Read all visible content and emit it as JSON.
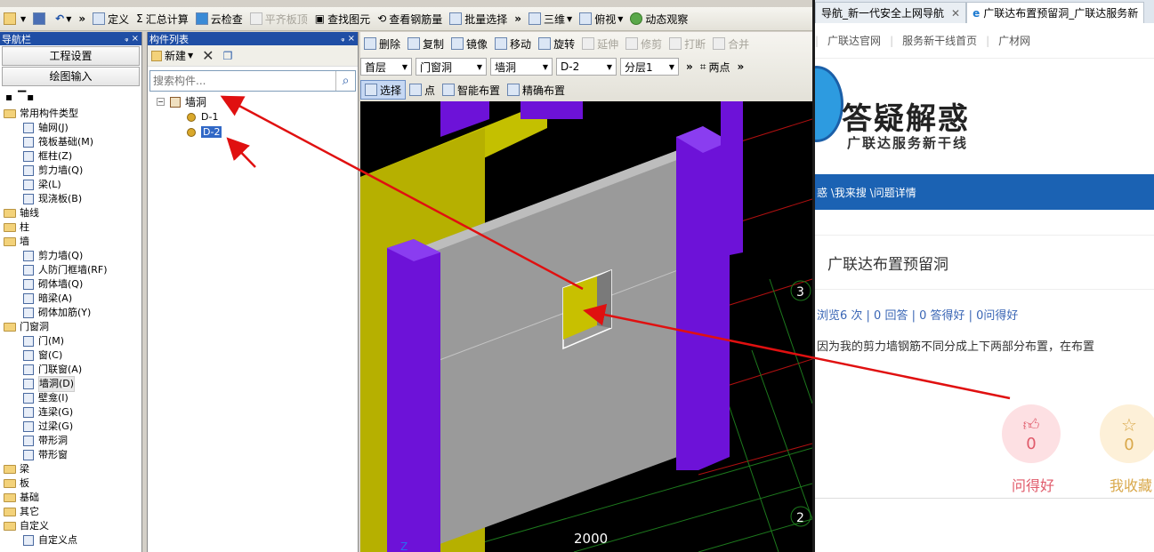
{
  "toolbar": {
    "items": [
      {
        "label": "",
        "icon": "open-folder-icon"
      },
      {
        "label": "",
        "icon": "save-icon"
      },
      {
        "label": "",
        "icon": "undo-icon"
      },
      {
        "label": "定义",
        "icon": "define-icon"
      },
      {
        "label": "汇总计算",
        "icon": "sigma-icon"
      },
      {
        "label": "云检查",
        "icon": "cloud-check-icon"
      },
      {
        "label": "平齐板顶",
        "icon": "align-slab-icon",
        "disabled": true
      },
      {
        "label": "查找图元",
        "icon": "binoculars-icon"
      },
      {
        "label": "查看钢筋量",
        "icon": "view-rebar-icon"
      },
      {
        "label": "批量选择",
        "icon": "batch-select-icon"
      },
      {
        "label": "三维",
        "icon": "cube-icon"
      },
      {
        "label": "俯视",
        "icon": "top-view-icon"
      },
      {
        "label": "动态观察",
        "icon": "orbit-icon"
      }
    ]
  },
  "nav_panel": {
    "title": "导航栏",
    "buttons": [
      "工程设置",
      "绘图输入"
    ],
    "tree": [
      {
        "label": "常用构件类型",
        "type": "folder",
        "level": 0
      },
      {
        "label": "轴网(J)",
        "type": "item",
        "level": 1
      },
      {
        "label": "筏板基础(M)",
        "type": "item",
        "level": 1
      },
      {
        "label": "框柱(Z)",
        "type": "item",
        "level": 1
      },
      {
        "label": "剪力墙(Q)",
        "type": "item",
        "level": 1
      },
      {
        "label": "梁(L)",
        "type": "item",
        "level": 1
      },
      {
        "label": "现浇板(B)",
        "type": "item",
        "level": 1
      },
      {
        "label": "轴线",
        "type": "folder",
        "level": 0
      },
      {
        "label": "柱",
        "type": "folder",
        "level": 0
      },
      {
        "label": "墙",
        "type": "folder",
        "level": 0
      },
      {
        "label": "剪力墙(Q)",
        "type": "item",
        "level": 1
      },
      {
        "label": "人防门框墙(RF)",
        "type": "item",
        "level": 1
      },
      {
        "label": "砌体墙(Q)",
        "type": "item",
        "level": 1
      },
      {
        "label": "暗梁(A)",
        "type": "item",
        "level": 1
      },
      {
        "label": "砌体加筋(Y)",
        "type": "item",
        "level": 1
      },
      {
        "label": "门窗洞",
        "type": "folder",
        "level": 0
      },
      {
        "label": "门(M)",
        "type": "item",
        "level": 1
      },
      {
        "label": "窗(C)",
        "type": "item",
        "level": 1
      },
      {
        "label": "门联窗(A)",
        "type": "item",
        "level": 1
      },
      {
        "label": "墙洞(D)",
        "type": "item",
        "level": 1,
        "active": true
      },
      {
        "label": "壁龛(I)",
        "type": "item",
        "level": 1
      },
      {
        "label": "连梁(G)",
        "type": "item",
        "level": 1
      },
      {
        "label": "过梁(G)",
        "type": "item",
        "level": 1
      },
      {
        "label": "带形洞",
        "type": "item",
        "level": 1
      },
      {
        "label": "带形窗",
        "type": "item",
        "level": 1
      },
      {
        "label": "梁",
        "type": "folder",
        "level": 0
      },
      {
        "label": "板",
        "type": "folder",
        "level": 0
      },
      {
        "label": "基础",
        "type": "folder",
        "level": 0
      },
      {
        "label": "其它",
        "type": "folder",
        "level": 0
      },
      {
        "label": "自定义",
        "type": "folder",
        "level": 0
      },
      {
        "label": "自定义点",
        "type": "item",
        "level": 1
      }
    ]
  },
  "comp_list": {
    "title": "构件列表",
    "new_label": "新建",
    "search_placeholder": "搜索构件...",
    "root": "墙洞",
    "items": [
      "D-1",
      "D-2"
    ],
    "selected": "D-2"
  },
  "draw_toolbar": {
    "row1": [
      {
        "label": "删除",
        "icon": "delete-icon"
      },
      {
        "label": "复制",
        "icon": "copy-icon"
      },
      {
        "label": "镜像",
        "icon": "mirror-icon"
      },
      {
        "label": "移动",
        "icon": "move-icon"
      },
      {
        "label": "旋转",
        "icon": "rotate-icon"
      },
      {
        "label": "延伸",
        "icon": "extend-icon",
        "disabled": true
      },
      {
        "label": "修剪",
        "icon": "trim-icon",
        "disabled": true
      },
      {
        "label": "打断",
        "icon": "break-icon",
        "disabled": true
      },
      {
        "label": "合并",
        "icon": "merge-icon",
        "disabled": true
      }
    ],
    "combos": [
      "首层",
      "门窗洞",
      "墙洞",
      "D-2",
      "分层1"
    ],
    "two_points": "两点",
    "row3": [
      {
        "label": "选择",
        "icon": "cursor-icon",
        "pressed": true
      },
      {
        "label": "点",
        "icon": "point-icon"
      },
      {
        "label": "智能布置",
        "icon": "smart-place-icon"
      },
      {
        "label": "精确布置",
        "icon": "precise-place-icon"
      }
    ]
  },
  "viewport": {
    "axis_labels": [
      "3",
      "2"
    ],
    "dimension": "2000",
    "colors": {
      "wall": "#9a9a9a",
      "column": "#6d12d8",
      "yellow_wall": "#c4c000",
      "opening": "#c8c000",
      "grid": "#1d7a1d",
      "grid_red": "#b01010"
    }
  },
  "browser": {
    "tabs": [
      {
        "label": "导航_新一代安全上网导航",
        "active": false
      },
      {
        "label": "广联达布置预留洞_广联达服务新",
        "active": true
      }
    ],
    "links": [
      "广联达官网",
      "服务新干线首页",
      "广材网"
    ],
    "banner_title": "答疑解惑",
    "banner_subtitle": "广联达服务新干线",
    "nav": "惑 \\我来搜 \\问题详情",
    "question_title": "广联达布置预留洞",
    "stats": "浏览6 次 | 0 回答 | 0 答得好 | 0问得好",
    "question_body": "因为我的剪力墙钢筋不同分成上下两部分布置，在布置",
    "actions": [
      {
        "label": "问得好",
        "count": "0",
        "color": "#e05a6a",
        "bg": "#fde0e3",
        "icon": "thumbs-up-icon"
      },
      {
        "label": "我收藏",
        "count": "0",
        "color": "#d9a84a",
        "bg": "#fdf0d8",
        "icon": "star-icon"
      }
    ]
  }
}
